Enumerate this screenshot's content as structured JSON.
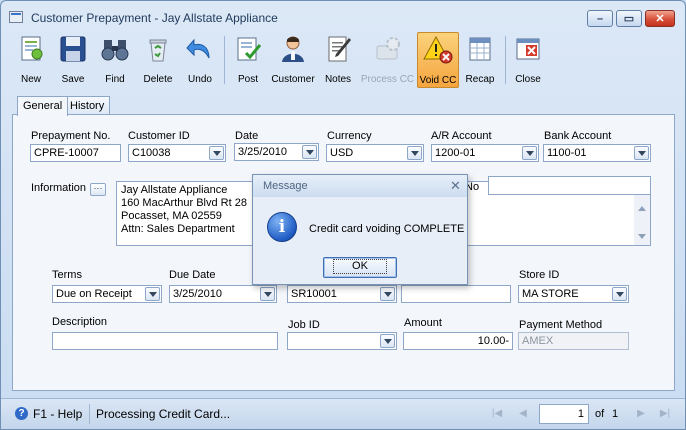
{
  "window": {
    "title": "Customer Prepayment - Jay Allstate Appliance"
  },
  "toolbar": {
    "new": "New",
    "save": "Save",
    "find": "Find",
    "delete": "Delete",
    "undo": "Undo",
    "post": "Post",
    "customer": "Customer",
    "notes": "Notes",
    "process_cc": "Process CC",
    "void_cc": "Void CC",
    "recap": "Recap",
    "close": "Close"
  },
  "tabs": {
    "general": "General",
    "history": "History"
  },
  "form": {
    "prepayment_no": {
      "label": "Prepayment No.",
      "value": "CPRE-10007"
    },
    "customer_id": {
      "label": "Customer ID",
      "value": "C10038"
    },
    "date": {
      "label": "Date",
      "value": "3/25/2010"
    },
    "currency": {
      "label": "Currency",
      "value": "USD"
    },
    "ar_account": {
      "label": "A/R Account",
      "value": "1200-01"
    },
    "bank_account": {
      "label": "Bank Account",
      "value": "1100-01"
    },
    "information": {
      "label": "Information",
      "lines": [
        "Jay Allstate Appliance",
        "160 MacArthur Blvd Rt 28",
        "Pocasset, MA 02559",
        "Attn: Sales Department"
      ]
    },
    "partial_label": "No",
    "terms": {
      "label": "Terms",
      "value": "Due on Receipt"
    },
    "due_date": {
      "label": "Due Date",
      "value": "3/25/2010"
    },
    "salesperson_partial": "SR10001",
    "store_id": {
      "label": "Store ID",
      "value": "MA STORE"
    },
    "description": {
      "label": "Description",
      "value": ""
    },
    "job_id": {
      "label": "Job ID",
      "value": ""
    },
    "amount": {
      "label": "Amount",
      "value": "10.00-"
    },
    "payment_method": {
      "label": "Payment Method",
      "value": "AMEX"
    }
  },
  "status": {
    "help": "F1 - Help",
    "message": "Processing Credit Card...",
    "page_current": "1",
    "page_of": "of",
    "page_total": "1"
  },
  "dialog": {
    "title": "Message",
    "message": "Credit card voiding COMPLETE",
    "ok": "OK"
  }
}
